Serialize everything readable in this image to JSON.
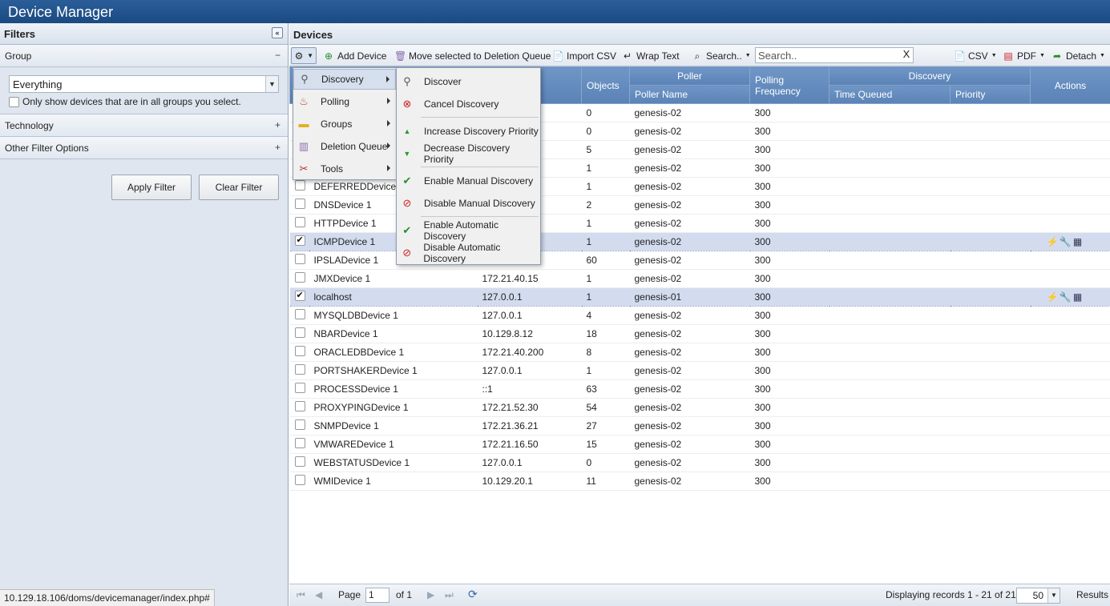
{
  "app": {
    "title": "Device Manager"
  },
  "filters": {
    "header": "Filters",
    "group": {
      "label": "Group",
      "toggle": "−",
      "selected": "Everything",
      "only_all_label": "Only show devices that are in all groups you select."
    },
    "technology": {
      "label": "Technology",
      "toggle": "+"
    },
    "other": {
      "label": "Other Filter Options",
      "toggle": "+"
    },
    "apply_label": "Apply Filter",
    "clear_label": "Clear Filter"
  },
  "status_url": "10.129.18.106/doms/devicemanager/index.php#",
  "devices": {
    "header": "Devices",
    "toolbar": {
      "add_device": "Add Device",
      "move_deletion": "Move selected to Deletion Queue",
      "import_csv": "Import CSV",
      "wrap_text": "Wrap Text",
      "search_menu": "Search..",
      "search_placeholder": "Search..",
      "search_clear": "X",
      "csv": "CSV",
      "pdf": "PDF",
      "detach": "Detach"
    },
    "columns": {
      "objects": "Objects",
      "poller_group": "Poller",
      "poller_name": "Poller Name",
      "polling_frequency": "Polling Frequency",
      "discovery_group": "Discovery",
      "time_queued": "Time Queued",
      "priority": "Priority",
      "actions": "Actions"
    },
    "rows": [
      {
        "name": "",
        "ip": "",
        "objects": "0",
        "poller": "genesis-02",
        "freq": "300",
        "checked": false,
        "hidden": true
      },
      {
        "name": "",
        "ip": "",
        "objects": "0",
        "poller": "genesis-02",
        "freq": "300",
        "checked": false,
        "hidden": true
      },
      {
        "name": "",
        "ip": "",
        "objects": "5",
        "poller": "genesis-02",
        "freq": "300",
        "checked": false,
        "hidden": true
      },
      {
        "name": "",
        "ip": "",
        "objects": "1",
        "poller": "genesis-02",
        "freq": "300",
        "checked": false,
        "hidden": true
      },
      {
        "name": "DEFERREDDevice 1",
        "ip": "",
        "objects": "1",
        "poller": "genesis-02",
        "freq": "300",
        "checked": false
      },
      {
        "name": "DNSDevice 1",
        "ip": "",
        "objects": "2",
        "poller": "genesis-02",
        "freq": "300",
        "checked": false
      },
      {
        "name": "HTTPDevice 1",
        "ip": "",
        "objects": "1",
        "poller": "genesis-02",
        "freq": "300",
        "checked": false
      },
      {
        "name": "ICMPDevice 1",
        "ip": "",
        "objects": "1",
        "poller": "genesis-02",
        "freq": "300",
        "checked": true
      },
      {
        "name": "IPSLADevice 1",
        "ip": "",
        "objects": "60",
        "poller": "genesis-02",
        "freq": "300",
        "checked": false
      },
      {
        "name": "JMXDevice 1",
        "ip": "172.21.40.15",
        "objects": "1",
        "poller": "genesis-02",
        "freq": "300",
        "checked": false
      },
      {
        "name": "localhost",
        "ip": "127.0.0.1",
        "objects": "1",
        "poller": "genesis-01",
        "freq": "300",
        "checked": true
      },
      {
        "name": "MYSQLDBDevice 1",
        "ip": "127.0.0.1",
        "objects": "4",
        "poller": "genesis-02",
        "freq": "300",
        "checked": false
      },
      {
        "name": "NBARDevice 1",
        "ip": "10.129.8.12",
        "objects": "18",
        "poller": "genesis-02",
        "freq": "300",
        "checked": false
      },
      {
        "name": "ORACLEDBDevice 1",
        "ip": "172.21.40.200",
        "objects": "8",
        "poller": "genesis-02",
        "freq": "300",
        "checked": false
      },
      {
        "name": "PORTSHAKERDevice 1",
        "ip": "127.0.0.1",
        "objects": "1",
        "poller": "genesis-02",
        "freq": "300",
        "checked": false
      },
      {
        "name": "PROCESSDevice 1",
        "ip": "::1",
        "objects": "63",
        "poller": "genesis-02",
        "freq": "300",
        "checked": false
      },
      {
        "name": "PROXYPINGDevice 1",
        "ip": "172.21.52.30",
        "objects": "54",
        "poller": "genesis-02",
        "freq": "300",
        "checked": false
      },
      {
        "name": "SNMPDevice 1",
        "ip": "172.21.36.21",
        "objects": "27",
        "poller": "genesis-02",
        "freq": "300",
        "checked": false
      },
      {
        "name": "VMWAREDevice 1",
        "ip": "172.21.16.50",
        "objects": "15",
        "poller": "genesis-02",
        "freq": "300",
        "checked": false
      },
      {
        "name": "WEBSTATUSDevice 1",
        "ip": "127.0.0.1",
        "objects": "0",
        "poller": "genesis-02",
        "freq": "300",
        "checked": false
      },
      {
        "name": "WMIDevice 1",
        "ip": "10.129.20.1",
        "objects": "11",
        "poller": "genesis-02",
        "freq": "300",
        "checked": false
      }
    ],
    "pager": {
      "page_label": "Page",
      "page": "1",
      "of": "of 1",
      "displaying": "Displaying records 1 - 21 of 21",
      "per_page": "50",
      "results": "Results"
    }
  },
  "context_menu": {
    "items": [
      {
        "label": "Discovery",
        "icon": "discovery-icon"
      },
      {
        "label": "Polling",
        "icon": "polling-icon"
      },
      {
        "label": "Groups",
        "icon": "folder-icon"
      },
      {
        "label": "Deletion Queue",
        "icon": "trash-icon"
      },
      {
        "label": "Tools",
        "icon": "tools-icon"
      }
    ]
  },
  "discovery_menu": {
    "items": [
      {
        "label": "Discover",
        "icon": "discover-icon"
      },
      {
        "label": "Cancel Discovery",
        "icon": "cancel-discovery-icon"
      },
      {
        "label": "Increase Discovery Priority",
        "icon": "arrow-up-icon"
      },
      {
        "label": "Decrease Discovery Priority",
        "icon": "arrow-down-icon"
      },
      {
        "label": "Enable Manual Discovery",
        "icon": "enable-manual-icon"
      },
      {
        "label": "Disable Manual Discovery",
        "icon": "disable-manual-icon"
      },
      {
        "label": "Enable Automatic Discovery",
        "icon": "enable-automatic-icon"
      },
      {
        "label": "Disable Automatic Discovery",
        "icon": "disable-automatic-icon"
      }
    ]
  }
}
